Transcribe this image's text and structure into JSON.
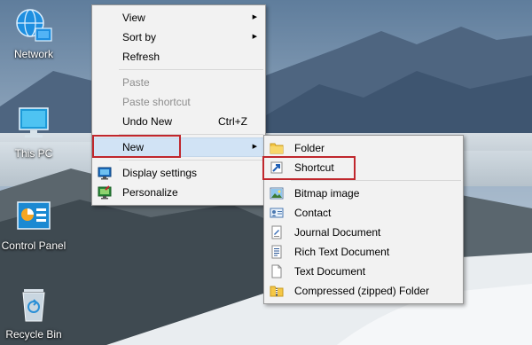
{
  "desktop_icons": [
    {
      "label": "Network",
      "icon": "network-icon"
    },
    {
      "label": "This PC",
      "icon": "this-pc-icon"
    },
    {
      "label": "Control Panel",
      "icon": "control-panel-icon"
    },
    {
      "label": "Recycle Bin",
      "icon": "recycle-bin-icon"
    }
  ],
  "context_menu": {
    "view": "View",
    "sort_by": "Sort by",
    "refresh": "Refresh",
    "paste": "Paste",
    "paste_shortcut": "Paste shortcut",
    "undo_new": "Undo New",
    "undo_new_accel": "Ctrl+Z",
    "new": "New",
    "display_settings": "Display settings",
    "personalize": "Personalize"
  },
  "new_submenu": {
    "items": [
      {
        "label": "Folder",
        "icon": "folder-icon"
      },
      {
        "label": "Shortcut",
        "icon": "shortcut-icon"
      },
      {
        "label": "Bitmap image",
        "icon": "bitmap-image-icon"
      },
      {
        "label": "Contact",
        "icon": "contact-icon"
      },
      {
        "label": "Journal Document",
        "icon": "journal-document-icon"
      },
      {
        "label": "Rich Text Document",
        "icon": "rich-text-document-icon"
      },
      {
        "label": "Text Document",
        "icon": "text-document-icon"
      },
      {
        "label": "Compressed (zipped) Folder",
        "icon": "zipped-folder-icon"
      }
    ]
  },
  "colors": {
    "highlight": "#d1e3f5",
    "callout": "#c0272d",
    "menu_bg": "#f2f2f2"
  }
}
